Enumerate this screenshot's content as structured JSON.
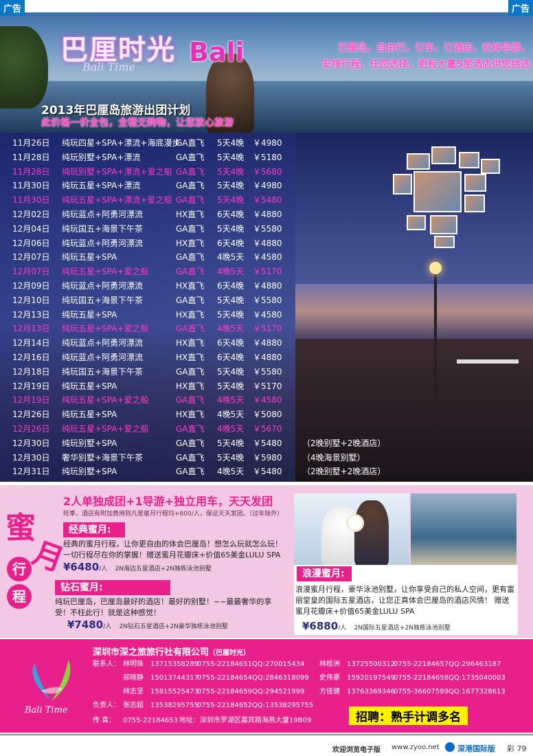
{
  "ad_label": "广告",
  "hero": {
    "logo_cn": "巴厘时光",
    "logo_en": "Bali Time",
    "bali": "Bali",
    "slogan_line1": "巴厘岛，自由行，订车，订酒店，安排导游，",
    "slogan_line2": "安排行程，任您选择，更有大量5星酒店供您挑选",
    "title": "2013年巴厘岛旅游出团计划",
    "subtitle": "此价格一价全包，全程无购物，让您放心旅游"
  },
  "schedule": [
    {
      "date": "11月26日",
      "route": "纯玩四星+SPA+漂流+海底漫步",
      "flight": "GA直飞",
      "days": "5天4晚",
      "price": "￥4980",
      "note": "",
      "hl": false
    },
    {
      "date": "11月28日",
      "route": "纯玩别墅+SPA+漂流",
      "flight": "GA直飞",
      "days": "5天4晚",
      "price": "￥5180",
      "note": "",
      "hl": false
    },
    {
      "date": "11月28日",
      "route": "纯玩别墅+SPA+漂流+爱之船",
      "flight": "GA直飞",
      "days": "5天4晚",
      "price": "￥5680",
      "note": "",
      "hl": true
    },
    {
      "date": "11月30日",
      "route": "纯玩五星+SPA+漂流",
      "flight": "GA直飞",
      "days": "5天4晚",
      "price": "￥4980",
      "note": "",
      "hl": false
    },
    {
      "date": "11月30日",
      "route": "纯玩五星+SPA+漂流+爱之船",
      "flight": "GA直飞",
      "days": "5天4晚",
      "price": "￥5480",
      "note": "",
      "hl": true
    },
    {
      "date": "12月02日",
      "route": "纯玩蓝点+阿勇河漂流",
      "flight": "HX直飞",
      "days": "6天4晚",
      "price": "￥4880",
      "note": "",
      "hl": false
    },
    {
      "date": "12月04日",
      "route": "纯玩国五+海景下午茶",
      "flight": "GA直飞",
      "days": "5天4晚",
      "price": "￥5580",
      "note": "",
      "hl": false
    },
    {
      "date": "12月06日",
      "route": "纯玩蓝点+阿勇河漂流",
      "flight": "HX直飞",
      "days": "6天4晚",
      "price": "￥4880",
      "note": "",
      "hl": false
    },
    {
      "date": "12月07日",
      "route": "纯玩五星+SPA",
      "flight": "GA直飞",
      "days": "4晚5天",
      "price": "￥4580",
      "note": "",
      "hl": false
    },
    {
      "date": "12月07日",
      "route": "纯玩五星+SPA+爱之船",
      "flight": "GA直飞",
      "days": "4晚5天",
      "price": "￥5170",
      "note": "",
      "hl": true
    },
    {
      "date": "12月09日",
      "route": "纯玩蓝点+阿勇河漂流",
      "flight": "HX直飞",
      "days": "6天4晚",
      "price": "￥4880",
      "note": "",
      "hl": false
    },
    {
      "date": "12月10日",
      "route": "纯玩国五+海景下午茶",
      "flight": "GA直飞",
      "days": "5天4晚",
      "price": "￥5580",
      "note": "",
      "hl": false
    },
    {
      "date": "12月13日",
      "route": "纯玩五星+SPA",
      "flight": "HX直飞",
      "days": "5天4晚",
      "price": "￥4580",
      "note": "",
      "hl": false
    },
    {
      "date": "12月13日",
      "route": "纯玩五星+SPA+爱之船",
      "flight": "GA直飞",
      "days": "4晚5天",
      "price": "￥5170",
      "note": "",
      "hl": true
    },
    {
      "date": "12月14日",
      "route": "纯玩蓝点+阿勇河漂流",
      "flight": "HX直飞",
      "days": "6天4晚",
      "price": "￥4880",
      "note": "",
      "hl": false
    },
    {
      "date": "12月16日",
      "route": "纯玩蓝点+阿勇河漂流",
      "flight": "HX直飞",
      "days": "6天4晚",
      "price": "￥4880",
      "note": "",
      "hl": false
    },
    {
      "date": "12月18日",
      "route": "纯玩国五+海景下午茶",
      "flight": "GA直飞",
      "days": "5天4晚",
      "price": "￥5580",
      "note": "",
      "hl": false
    },
    {
      "date": "12月19日",
      "route": "纯玩五星+SPA",
      "flight": "HX直飞",
      "days": "5天4晚",
      "price": "￥5170",
      "note": "",
      "hl": false
    },
    {
      "date": "12月19日",
      "route": "纯玩五星+SPA+爱之船",
      "flight": "GA直飞",
      "days": "4晚5天",
      "price": "￥4580",
      "note": "",
      "hl": true
    },
    {
      "date": "12月26日",
      "route": "纯玩五星+SPA",
      "flight": "HX直飞",
      "days": "4晚5天",
      "price": "￥5080",
      "note": "",
      "hl": false
    },
    {
      "date": "12月26日",
      "route": "纯玩五星+SPA+爱之船",
      "flight": "GA直飞",
      "days": "4晚5天",
      "price": "￥5670",
      "note": "",
      "hl": true
    },
    {
      "date": "12月30日",
      "route": "纯玩别墅+SPA",
      "flight": "GA直飞",
      "days": "5天4晚",
      "price": "￥5480",
      "note": "（2晚别墅+2晚酒店）",
      "hl": false
    },
    {
      "date": "12月30日",
      "route": "奢华别墅+海景下午茶",
      "flight": "GA直飞",
      "days": "5天4晚",
      "price": "￥5980",
      "note": "（4晚海景别墅）",
      "hl": false
    },
    {
      "date": "12月31日",
      "route": "纯玩别墅+SPA",
      "flight": "GA直飞",
      "days": "4晚5天",
      "price": "￥5480",
      "note": "（2晚别墅+2晚酒店）",
      "hl": false
    }
  ],
  "honeymoon": {
    "side_mi": "蜜",
    "side_yue": "月",
    "side_xing": "行",
    "side_cheng": "程",
    "title": "2人单独成团+1导游+独立用车，天天发团",
    "note": "旺季，酒店有附加费用则凡是蜜月行程均+600/人，保证天天发团。（过年除外）",
    "classic_tag": "经典蜜月:",
    "classic_text1": "经典的蜜月行程，让你更自由的体会巴厘岛！想怎么玩就怎么玩！",
    "classic_text2": "一切行程尽在你的掌握！赠送蜜月花瓣床+价值65美金LULU SPA",
    "classic_price": "¥6480",
    "classic_unit": "/人",
    "classic_detail": "2N海边五星酒店+2N独栋泳池别墅",
    "diamond_tag": "钻石蜜月:",
    "diamond_text1": "纯玩巴厘岛，巴厘岛最好的酒店！最好的别墅！~~最最奢华的享",
    "diamond_text2": "受！不枉此行！就是这种感觉！",
    "diamond_price": "¥7480",
    "diamond_unit": "/人",
    "diamond_detail": "2N钻石五星酒店+2N豪华独栋泳池别墅",
    "romantic_tag": "浪漫蜜月:",
    "romantic_text1": "浪漫蜜月行程，豪华泳池别墅，让你享受自己的私人空间，更有富",
    "romantic_text2": "丽堂皇的国际五星酒店，让您正真体会巴厘岛的酒店风情！  赠送",
    "romantic_text3": "蜜月花瓣床+价值65美金LULU SPA",
    "romantic_price": "¥6880",
    "romantic_unit": "/人",
    "romantic_detail": "2N国际五星酒店+2N独栋泳池别墅"
  },
  "contact": {
    "logo_text": "Bali Time",
    "company": "深圳市深之旅旅行社有限公司",
    "company_suffix": "（巴厘时光）",
    "rows": [
      {
        "label": "联系人：",
        "name": "林明珠",
        "mobile": "13715358289",
        "tel": "0755-22184651",
        "qq": "QQ:270015434",
        "name2": "林桂洲",
        "mobile2": "13725500312",
        "tel2": "0755-22184657",
        "qq2": "QQ:296463187"
      },
      {
        "label": "",
        "name": "郑晓静",
        "mobile": "15013744317",
        "tel": "0755-22184654",
        "qq": "QQ:2846318099",
        "name2": "史伟豪",
        "mobile2": "15920197549",
        "tel2": "0755-22184658",
        "qq2": "QQ:1735040003"
      },
      {
        "label": "",
        "name": "林志坚",
        "mobile": "15815525473",
        "tel": "0755-22184659",
        "qq": "QQ:294521999",
        "name2": "方佳健",
        "mobile2": "13763369346",
        "tel2": "0755-36607589",
        "qq2": "QQ:1677328613"
      },
      {
        "label": "负责人：",
        "name": "张志超",
        "mobile": "13538295755",
        "tel": "0755-22184652",
        "qq": "QQ:13538295755",
        "name2": "",
        "mobile2": "",
        "tel2": "",
        "qq2": ""
      }
    ],
    "fax_label": "传    真：",
    "fax": "0755-22184653",
    "addr_label": "地址：",
    "addr": "深圳市罗湖区嘉宾路海燕大厦19B09",
    "recruit": "招聘：熟手计调多名"
  },
  "footer": {
    "welcome": "欢迎浏览电子版",
    "url": "www.zyoo.net",
    "edition": "深港国际版",
    "page": "彩 79"
  }
}
